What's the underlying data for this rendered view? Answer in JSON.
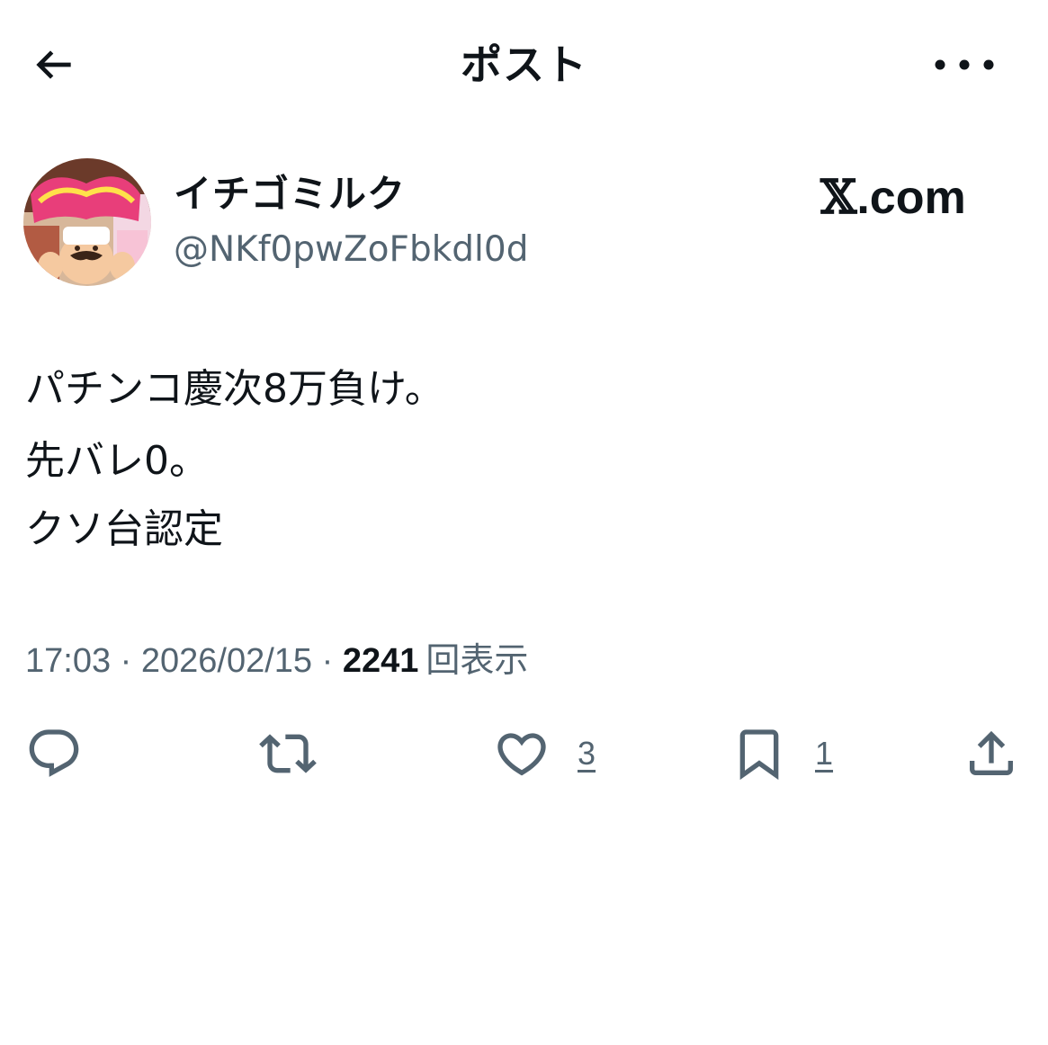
{
  "header": {
    "title": "ポスト",
    "back_icon": "arrow-left-icon",
    "more_icon": "more-horizontal-icon"
  },
  "author": {
    "display_name": "イチゴミルク",
    "handle": "@NKf0pwZoFbkdl0d",
    "avatar_icon": "avatar-image"
  },
  "watermark": {
    "x": "𝕏",
    "rest": ".com"
  },
  "post": {
    "lines": [
      "パチンコ慶次8万負け。",
      "先バレ0。",
      "クソ台認定"
    ]
  },
  "meta": {
    "time": "17:03",
    "separator": " · ",
    "date": "2026/02/15",
    "views_count": "2241",
    "views_label": "回表示"
  },
  "actions": {
    "reply": {
      "icon": "reply-icon"
    },
    "repost": {
      "icon": "repost-icon"
    },
    "like": {
      "icon": "heart-icon",
      "count": "3"
    },
    "bookmark": {
      "icon": "bookmark-icon",
      "count": "1"
    },
    "share": {
      "icon": "share-icon"
    }
  },
  "colors": {
    "text": "#0f1419",
    "secondary": "#536471",
    "background": "#ffffff"
  }
}
